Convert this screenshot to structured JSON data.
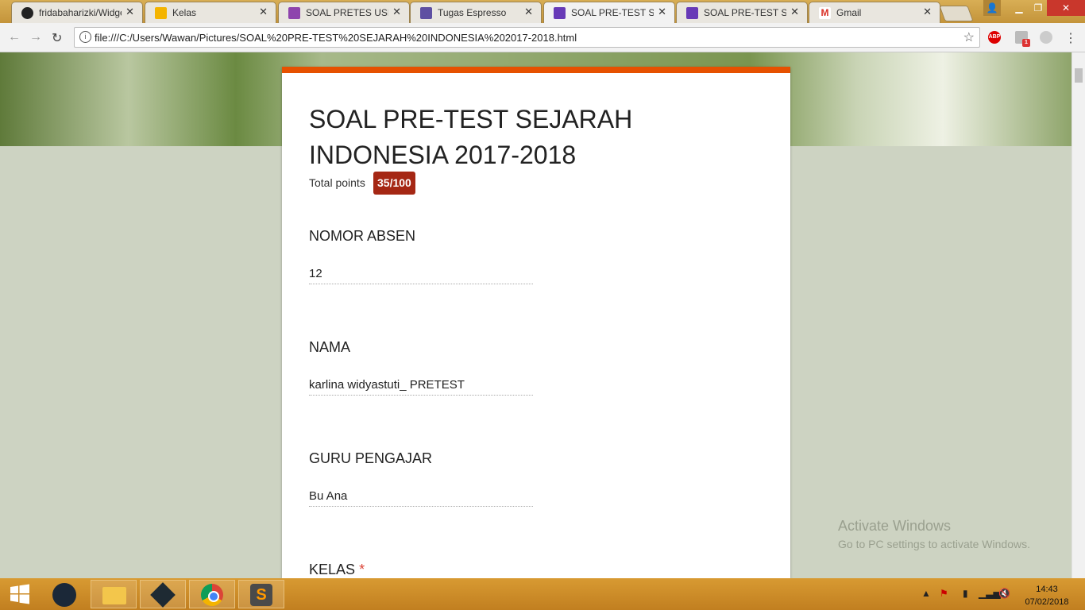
{
  "browser": {
    "tabs": [
      {
        "label": "fridabaharizki/Widget",
        "icon": "github-icon",
        "color": "#222222"
      },
      {
        "label": "Kelas",
        "icon": "classroom-icon",
        "color": "#f4b400"
      },
      {
        "label": "SOAL PRETES USBN",
        "icon": "contacts-icon",
        "color": "#8e44ad"
      },
      {
        "label": "Tugas Espresso",
        "icon": "contacts-icon",
        "color": "#5e4fa2"
      },
      {
        "label": "SOAL PRE-TEST SEJARAH",
        "icon": "forms-icon",
        "color": "#673ab7"
      },
      {
        "label": "SOAL PRE-TEST SEJARAH",
        "icon": "forms-icon",
        "color": "#673ab7"
      },
      {
        "label": "Gmail",
        "icon": "gmail-icon",
        "color": "#d93025"
      }
    ],
    "active_tab": 4,
    "url": "file:///C:/Users/Wawan/Pictures/SOAL%20PRE-TEST%20SEJARAH%20INDONESIA%202017-2018.html",
    "extensions": [
      "ABP",
      "1"
    ]
  },
  "form": {
    "title": "SOAL PRE-TEST SEJARAH INDONESIA 2017-2018",
    "total_points_label": "Total points",
    "score": "35/100",
    "accent_color": "#e65100",
    "questions": [
      {
        "label": "NOMOR ABSEN",
        "answer": "12",
        "required": false
      },
      {
        "label": "NAMA",
        "answer": "karlina widyastuti_ PRETEST",
        "required": false
      },
      {
        "label": "GURU PENGAJAR",
        "answer": "Bu Ana",
        "required": false
      },
      {
        "label": "KELAS",
        "required_marker": "*",
        "required": true
      }
    ]
  },
  "watermark": {
    "title": "Activate Windows",
    "subtitle": "Go to PC settings to activate Windows."
  },
  "taskbar": {
    "apps": [
      "start-icon",
      "steam-icon",
      "file-explorer-icon",
      "nox-icon",
      "chrome-icon",
      "sublime-text-icon"
    ],
    "time": "14:43",
    "date": "07/02/2018"
  }
}
